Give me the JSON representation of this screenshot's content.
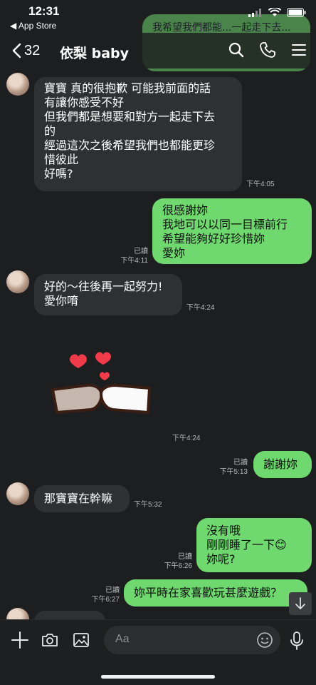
{
  "status_bar": {
    "time": "12:31",
    "back_app": "◀ App Store"
  },
  "header": {
    "unread_count": "32",
    "chat_title": "依梨 baby"
  },
  "faded_top_message": "我希望我們都能...一起走下去...",
  "messages": [
    {
      "id": "m1",
      "lines": [
        "寶寶 真的很抱歉 可能我前面的話",
        "有讓你感受不好",
        "但我們都是想要和對方一起走下去",
        "的",
        "經過這次之後希望我們也都能更珍",
        "惜彼此",
        "好嗎?"
      ],
      "time": "下午4:05"
    },
    {
      "id": "m2",
      "lines": [
        "很感謝妳",
        "我地可以以同一目標前行",
        "希望能夠好好珍惜妳",
        "愛妳"
      ],
      "read": "已讀",
      "time": "下午4:11"
    },
    {
      "id": "m3",
      "lines": [
        "好的～往後再一起努力!",
        "愛你唷"
      ],
      "time": "下午4:24"
    },
    {
      "id": "m4_sticker",
      "time": "下午4:24"
    },
    {
      "id": "m5",
      "lines": [
        "謝謝妳"
      ],
      "read": "已讀",
      "time": "下午5:13"
    },
    {
      "id": "m6",
      "lines": [
        "那寶寶在幹嘛"
      ],
      "time": "下午5:32"
    },
    {
      "id": "m7",
      "lines": [
        "沒有哦",
        "剛剛睡了一下😊",
        "妳呢?"
      ],
      "read": "已讀",
      "time": "下午6:26"
    },
    {
      "id": "m8",
      "lines": [
        "妳平時在家喜歡玩甚麼遊戲？"
      ],
      "read": "已讀",
      "time": "下午6:27"
    }
  ],
  "input": {
    "placeholder": "Aa"
  },
  "colors": {
    "background": "#1d1e20",
    "incoming_bubble": "#2f3032",
    "outgoing_bubble": "#6fd86e"
  },
  "icons": [
    "chevron-left-icon",
    "search-icon",
    "phone-icon",
    "menu-icon",
    "plus-icon",
    "camera-icon",
    "image-icon",
    "emoji-icon",
    "microphone-icon",
    "arrow-down-icon"
  ]
}
